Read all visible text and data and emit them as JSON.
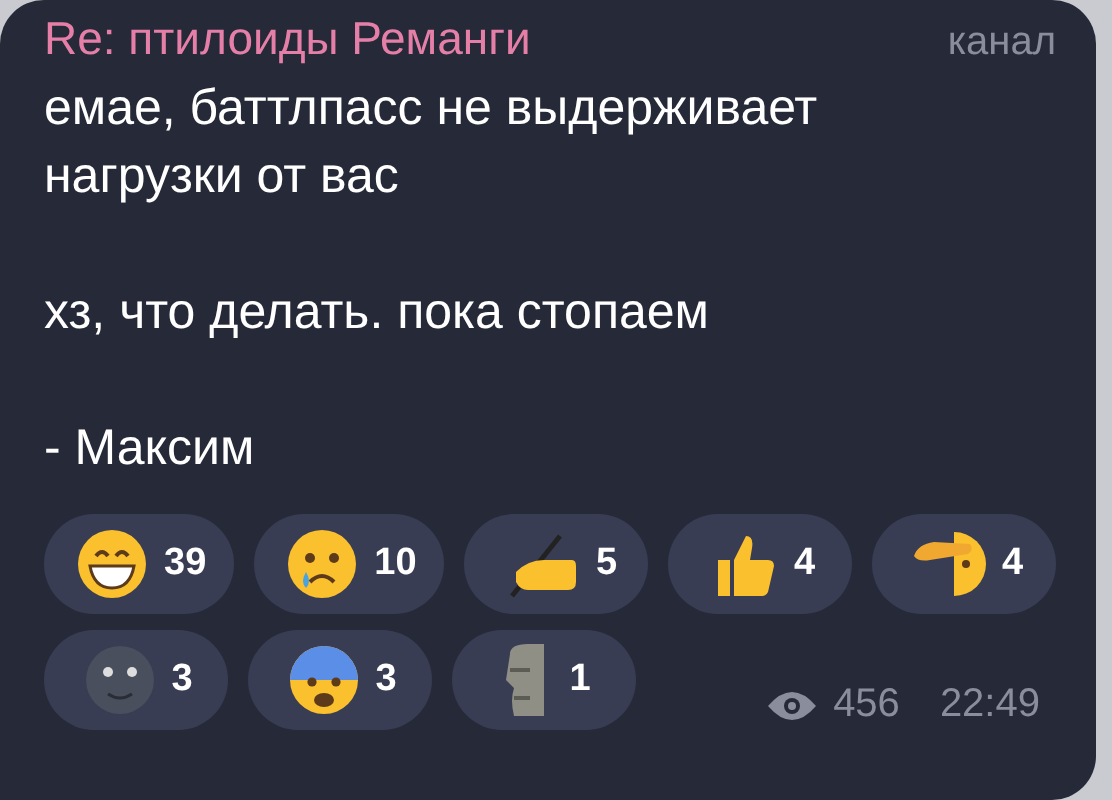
{
  "message": {
    "title": "Re: птилоиды Реманги",
    "badge": "канал",
    "paragraphs": [
      "емае, баттлпасс не выдерживает\nнагрузки от вас",
      "хз, что делать. пока стопаем",
      "- Максим"
    ],
    "reactions": [
      {
        "kind": "grin",
        "count": "39"
      },
      {
        "kind": "cry",
        "count": "10"
      },
      {
        "kind": "writing",
        "count": "5"
      },
      {
        "kind": "thumbs",
        "count": "4"
      },
      {
        "kind": "salute",
        "count": "4"
      },
      {
        "kind": "moon",
        "count": "3"
      },
      {
        "kind": "fear",
        "count": "3"
      },
      {
        "kind": "moai",
        "count": "1"
      }
    ],
    "views": "456",
    "time": "22:49"
  }
}
